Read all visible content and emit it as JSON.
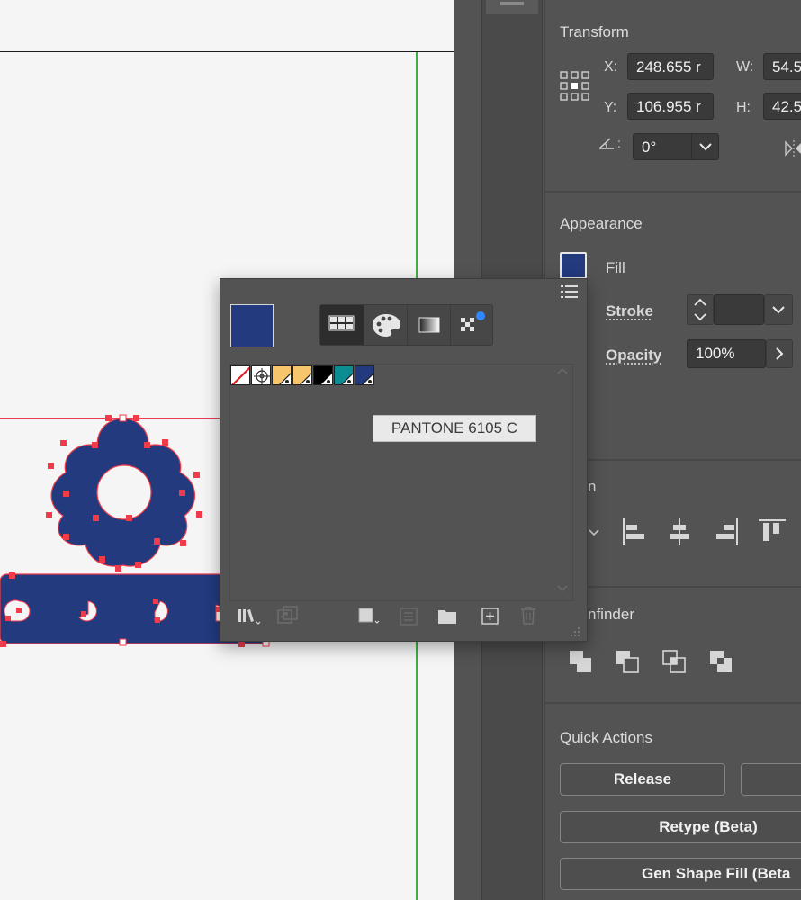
{
  "canvas": {
    "fill_color": "#233a7f",
    "selection_color": "#f03b4a",
    "guide_color": "#3cb043"
  },
  "transform": {
    "title": "Transform",
    "x_label": "X:",
    "x_value": "248.655 r",
    "y_label": "Y:",
    "y_value": "106.955 r",
    "w_label": "W:",
    "w_value": "54.5",
    "h_label": "H:",
    "h_value": "42.5",
    "angle_value": "0°"
  },
  "appearance": {
    "title": "Appearance",
    "fill_label": "Fill",
    "fill_color": "#233a7f",
    "stroke_label": "Stroke",
    "opacity_label": "Opacity",
    "opacity_value": "100%"
  },
  "align": {
    "title_partial": "n"
  },
  "pathfinder": {
    "title_partial": "nfinder"
  },
  "quick_actions": {
    "title": "Quick Actions",
    "release": "Release",
    "retype": "Retype (Beta)",
    "gen_shape_fill": "Gen Shape Fill (Beta"
  },
  "swatches_popup": {
    "current_fill_color": "#233a7f",
    "tabs": [
      "swatches-grid-icon",
      "color-palette-icon",
      "gradient-icon",
      "pattern-icon"
    ],
    "tooltip": "PANTONE 6105 C",
    "swatches": [
      {
        "name": "none",
        "color": "#ffffff"
      },
      {
        "name": "registration",
        "color": "#ffffff"
      },
      {
        "name": "spot-orange-1",
        "color": "#f7c56b"
      },
      {
        "name": "spot-orange-2",
        "color": "#f7c56b"
      },
      {
        "name": "spot-black",
        "color": "#000000"
      },
      {
        "name": "spot-teal",
        "color": "#0c8d92"
      },
      {
        "name": "spot-navy",
        "color": "#233a7f"
      }
    ]
  }
}
